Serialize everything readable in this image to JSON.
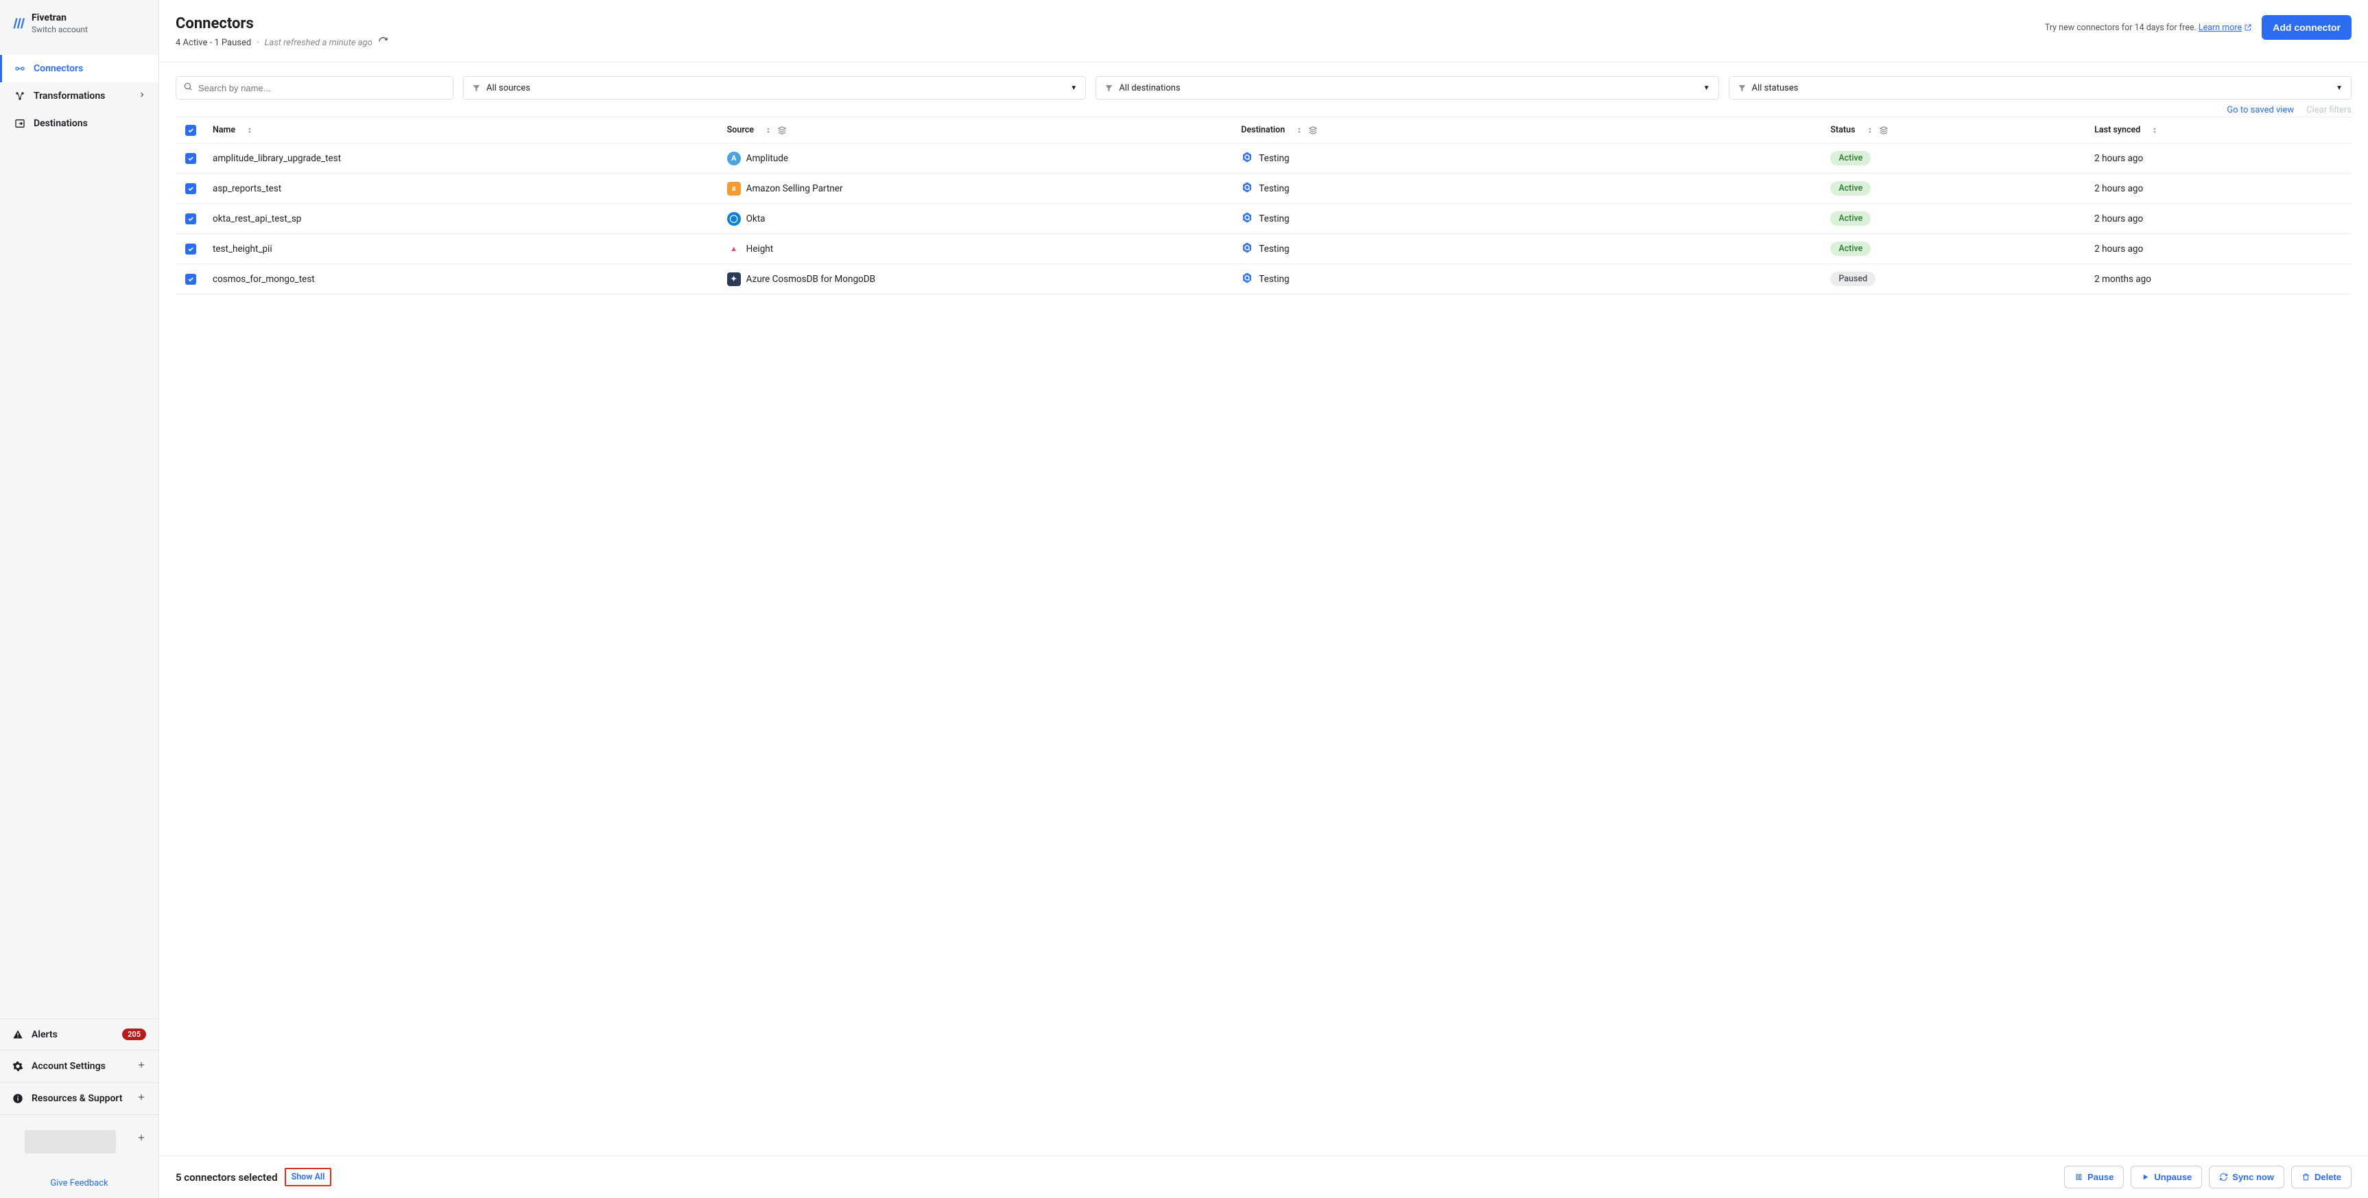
{
  "sidebar": {
    "brand": "Fivetran",
    "switch_account": "Switch account",
    "nav": [
      {
        "label": "Connectors",
        "active": true
      },
      {
        "label": "Transformations",
        "active": false
      },
      {
        "label": "Destinations",
        "active": false
      }
    ],
    "alerts": {
      "label": "Alerts",
      "count": "205"
    },
    "account_settings": "Account Settings",
    "resources_support": "Resources & Support",
    "give_feedback": "Give Feedback"
  },
  "header": {
    "title": "Connectors",
    "status_summary": "4 Active - 1 Paused",
    "separator": "·",
    "last_refreshed": "Last refreshed a minute ago",
    "try_text": "Try new connectors for 14 days for free.",
    "learn_more": "Learn more",
    "add_connector": "Add connector"
  },
  "filters": {
    "search_placeholder": "Search by name...",
    "sources": "All sources",
    "destinations": "All destinations",
    "statuses": "All statuses",
    "saved_view": "Go to saved view",
    "clear_filters": "Clear filters"
  },
  "table": {
    "columns": {
      "name": "Name",
      "source": "Source",
      "destination": "Destination",
      "status": "Status",
      "last_synced": "Last synced"
    },
    "rows": [
      {
        "name": "amplitude_library_upgrade_test",
        "source": "Amplitude",
        "destination": "Testing",
        "status": "Active",
        "last_synced": "2 hours ago",
        "src_icon": "A",
        "src_color": "#4aa3df",
        "src_round": true
      },
      {
        "name": "asp_reports_test",
        "source": "Amazon Selling Partner",
        "destination": "Testing",
        "status": "Active",
        "last_synced": "2 hours ago",
        "src_icon": "a",
        "src_color": "#f29b30",
        "src_round": false
      },
      {
        "name": "okta_rest_api_test_sp",
        "source": "Okta",
        "destination": "Testing",
        "status": "Active",
        "last_synced": "2 hours ago",
        "src_icon": "◯",
        "src_color": "#0f7fd1",
        "src_round": true
      },
      {
        "name": "test_height_pii",
        "source": "Height",
        "destination": "Testing",
        "status": "Active",
        "last_synced": "2 hours ago",
        "src_icon": "▲",
        "src_color": "#ffffff",
        "src_round": false,
        "src_fg": "#d14a8f"
      },
      {
        "name": "cosmos_for_mongo_test",
        "source": "Azure CosmosDB for MongoDB",
        "destination": "Testing",
        "status": "Paused",
        "last_synced": "2 months ago",
        "src_icon": "✦",
        "src_color": "#2b3a57",
        "src_round": false
      }
    ]
  },
  "bottombar": {
    "selected_text": "5 connectors selected",
    "show_all": "Show All",
    "pause": "Pause",
    "unpause": "Unpause",
    "sync_now": "Sync now",
    "delete": "Delete"
  }
}
